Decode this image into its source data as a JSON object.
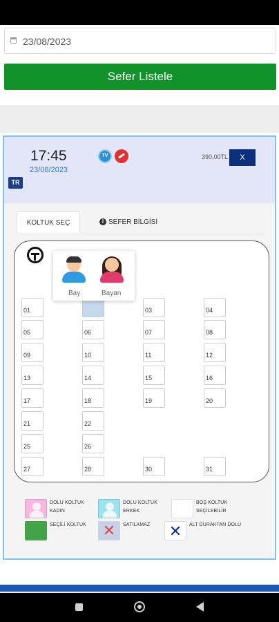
{
  "search": {
    "date_value": "23/08/2023",
    "list_button": "Sefer Listele"
  },
  "trip": {
    "time": "17:45",
    "date": "23/08/2023",
    "price": "390,00TL",
    "close_label": "X",
    "badge": "TR",
    "icons": [
      "tv-icon",
      "no-smoking-icon"
    ]
  },
  "tabs": {
    "seat_select": "KOLTUK SEÇ",
    "trip_info": "SEFER BİLGİSİ"
  },
  "gender_popup": {
    "male": "Bay",
    "female": "Bayan"
  },
  "seats": [
    "01",
    "",
    "03",
    "04",
    "05",
    "06",
    "07",
    "08",
    "09",
    "10",
    "11",
    "12",
    "13",
    "14",
    "15",
    "16",
    "17",
    "18",
    "19",
    "20",
    "21",
    "22",
    "25",
    "26",
    "27",
    "28",
    "30",
    "31"
  ],
  "legend": {
    "woman": "DOLU KOLTUK KADIN",
    "man": "DOLU KOLTUK ERKEK",
    "empty": "BOŞ KOLTUK SEÇİLEBİLİR",
    "selected": "SEÇİLİ KOLTUK",
    "not_for_sale": "SATILAMAZ",
    "lower_stop": "ALT DURAKTAN DOLU"
  },
  "colors": {
    "primary_green": "#11922a",
    "navy": "#0b2f7a",
    "card_border": "#7ec3ea",
    "footer_blue": "#1b57b3"
  }
}
